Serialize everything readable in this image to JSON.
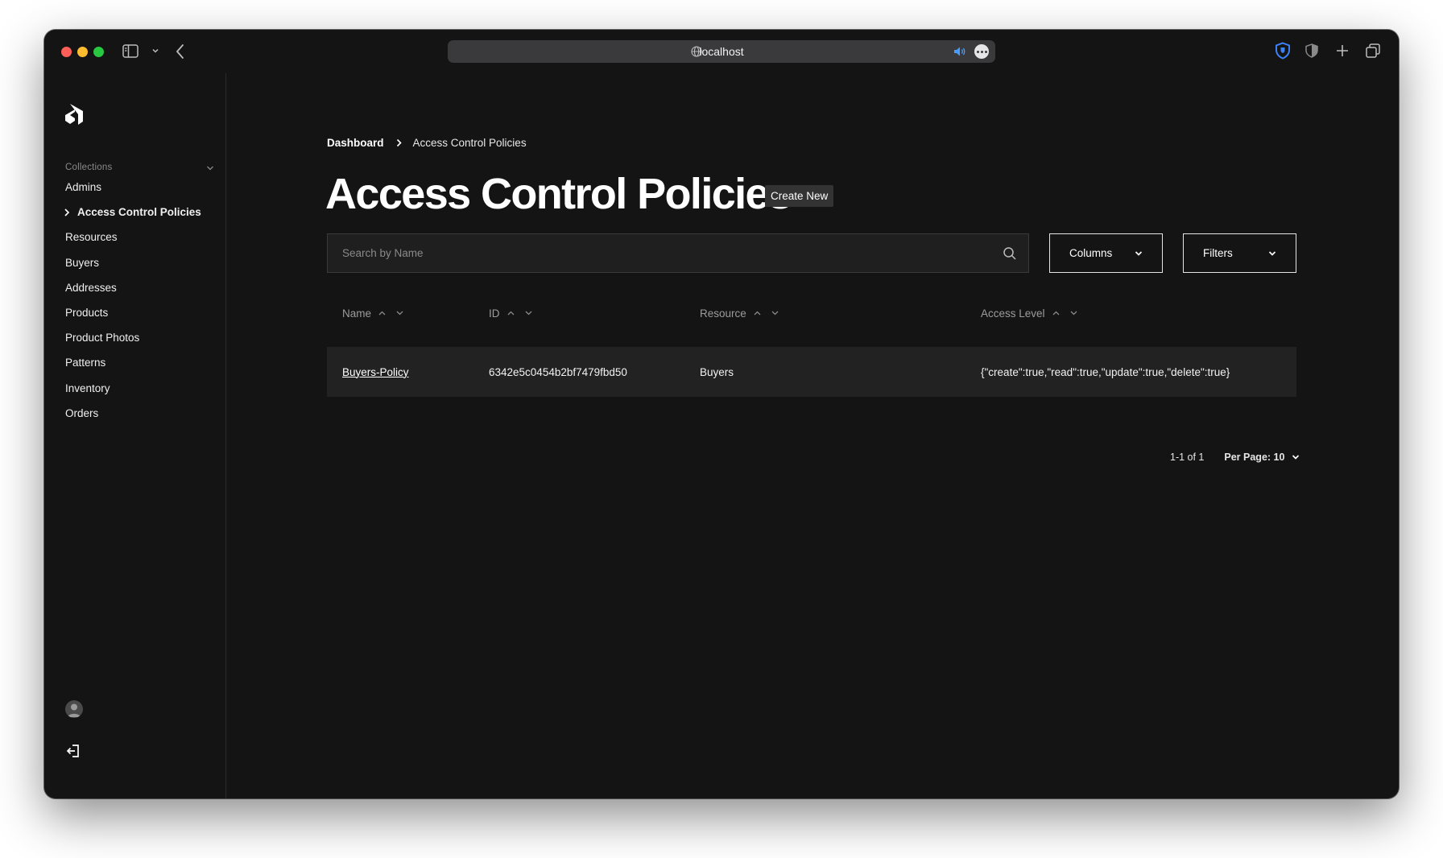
{
  "browser": {
    "url": "localhost",
    "colors": {
      "close": "#ff5f57",
      "minimize": "#febc2e",
      "maximize": "#28c840",
      "shield": "#3b82f6"
    }
  },
  "sidebar": {
    "collections_label": "Collections",
    "active_item": "Access Control Policies",
    "items": [
      {
        "label": "Admins"
      },
      {
        "label": "Access Control Policies"
      },
      {
        "label": "Resources"
      },
      {
        "label": "Buyers"
      },
      {
        "label": "Addresses"
      },
      {
        "label": "Products"
      },
      {
        "label": "Product Photos"
      },
      {
        "label": "Patterns"
      },
      {
        "label": "Inventory"
      },
      {
        "label": "Orders"
      }
    ]
  },
  "breadcrumb": {
    "home": "Dashboard",
    "current": "Access Control Policies"
  },
  "page": {
    "title": "Access Control Policies",
    "create_label": "Create New"
  },
  "search": {
    "placeholder": "Search by Name",
    "value": ""
  },
  "controls": {
    "columns_label": "Columns",
    "filters_label": "Filters"
  },
  "table": {
    "columns": [
      "Name",
      "ID",
      "Resource",
      "Access Level"
    ],
    "rows": [
      {
        "name": "Buyers-Policy",
        "id": "6342e5c0454b2bf7479fbd50",
        "resource": "Buyers",
        "access_level": "{\"create\":true,\"read\":true,\"update\":true,\"delete\":true}"
      }
    ]
  },
  "pagination": {
    "count": "1-1 of 1",
    "per_page": "Per Page: 10"
  }
}
